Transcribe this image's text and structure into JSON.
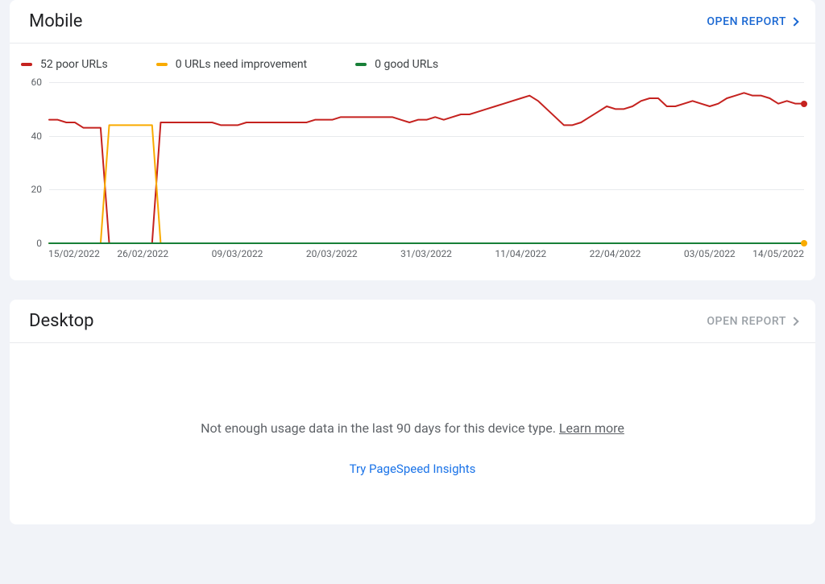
{
  "mobile": {
    "title": "Mobile",
    "open_report": "OPEN REPORT",
    "open_report_enabled": true,
    "legend": {
      "poor": "52 poor URLs",
      "need": "0 URLs need improvement",
      "good": "0 good URLs"
    }
  },
  "desktop": {
    "title": "Desktop",
    "open_report": "OPEN REPORT",
    "open_report_enabled": false,
    "empty_message": "Not enough usage data in the last 90 days for this device type. ",
    "learn_more": "Learn more",
    "try_link": "Try PageSpeed Insights"
  },
  "colors": {
    "poor": "#c5221f",
    "need": "#f9ab00",
    "good": "#188038",
    "link": "#1a73e8"
  },
  "chart_data": {
    "type": "line",
    "title": "",
    "xlabel": "",
    "ylabel": "",
    "ylim": [
      0,
      60
    ],
    "y_ticks": [
      0,
      20,
      40,
      60
    ],
    "x_tick_labels": [
      "15/02/2022",
      "26/02/2022",
      "09/03/2022",
      "20/03/2022",
      "31/03/2022",
      "11/04/2022",
      "22/04/2022",
      "03/05/2022",
      "14/05/2022"
    ],
    "x_tick_positions": [
      0,
      11,
      22,
      33,
      44,
      55,
      66,
      77,
      88
    ],
    "series": [
      {
        "name": "poor",
        "color": "#c5221f",
        "end_marker": true,
        "data": [
          [
            0,
            46
          ],
          [
            1,
            46
          ],
          [
            2,
            45
          ],
          [
            3,
            45
          ],
          [
            4,
            43
          ],
          [
            5,
            43
          ],
          [
            6,
            43
          ],
          [
            7,
            0
          ],
          [
            8,
            0
          ],
          [
            9,
            0
          ],
          [
            10,
            0
          ],
          [
            11,
            0
          ],
          [
            12,
            0
          ],
          [
            13,
            45
          ],
          [
            14,
            45
          ],
          [
            15,
            45
          ],
          [
            16,
            45
          ],
          [
            17,
            45
          ],
          [
            18,
            45
          ],
          [
            19,
            45
          ],
          [
            20,
            44
          ],
          [
            21,
            44
          ],
          [
            22,
            44
          ],
          [
            23,
            45
          ],
          [
            24,
            45
          ],
          [
            25,
            45
          ],
          [
            26,
            45
          ],
          [
            27,
            45
          ],
          [
            28,
            45
          ],
          [
            29,
            45
          ],
          [
            30,
            45
          ],
          [
            31,
            46
          ],
          [
            32,
            46
          ],
          [
            33,
            46
          ],
          [
            34,
            47
          ],
          [
            35,
            47
          ],
          [
            36,
            47
          ],
          [
            37,
            47
          ],
          [
            38,
            47
          ],
          [
            39,
            47
          ],
          [
            40,
            47
          ],
          [
            41,
            46
          ],
          [
            42,
            45
          ],
          [
            43,
            46
          ],
          [
            44,
            46
          ],
          [
            45,
            47
          ],
          [
            46,
            46
          ],
          [
            47,
            47
          ],
          [
            48,
            48
          ],
          [
            49,
            48
          ],
          [
            50,
            49
          ],
          [
            51,
            50
          ],
          [
            52,
            51
          ],
          [
            53,
            52
          ],
          [
            54,
            53
          ],
          [
            55,
            54
          ],
          [
            56,
            55
          ],
          [
            57,
            53
          ],
          [
            58,
            50
          ],
          [
            59,
            47
          ],
          [
            60,
            44
          ],
          [
            61,
            44
          ],
          [
            62,
            45
          ],
          [
            63,
            47
          ],
          [
            64,
            49
          ],
          [
            65,
            51
          ],
          [
            66,
            50
          ],
          [
            67,
            50
          ],
          [
            68,
            51
          ],
          [
            69,
            53
          ],
          [
            70,
            54
          ],
          [
            71,
            54
          ],
          [
            72,
            51
          ],
          [
            73,
            51
          ],
          [
            74,
            52
          ],
          [
            75,
            53
          ],
          [
            76,
            52
          ],
          [
            77,
            51
          ],
          [
            78,
            52
          ],
          [
            79,
            54
          ],
          [
            80,
            55
          ],
          [
            81,
            56
          ],
          [
            82,
            55
          ],
          [
            83,
            55
          ],
          [
            84,
            54
          ],
          [
            85,
            52
          ],
          [
            86,
            53
          ],
          [
            87,
            52
          ],
          [
            88,
            52
          ]
        ]
      },
      {
        "name": "need_improvement",
        "color": "#f9ab00",
        "end_marker": true,
        "data": [
          [
            0,
            0
          ],
          [
            1,
            0
          ],
          [
            2,
            0
          ],
          [
            3,
            0
          ],
          [
            4,
            0
          ],
          [
            5,
            0
          ],
          [
            6,
            0
          ],
          [
            7,
            44
          ],
          [
            8,
            44
          ],
          [
            9,
            44
          ],
          [
            10,
            44
          ],
          [
            11,
            44
          ],
          [
            12,
            44
          ],
          [
            13,
            0
          ],
          [
            14,
            0
          ],
          [
            20,
            0
          ],
          [
            30,
            0
          ],
          [
            40,
            0
          ],
          [
            50,
            0
          ],
          [
            60,
            0
          ],
          [
            70,
            0
          ],
          [
            80,
            0
          ],
          [
            88,
            0
          ]
        ]
      },
      {
        "name": "good",
        "color": "#188038",
        "end_marker": false,
        "data": [
          [
            0,
            0
          ],
          [
            88,
            0
          ]
        ]
      }
    ]
  }
}
